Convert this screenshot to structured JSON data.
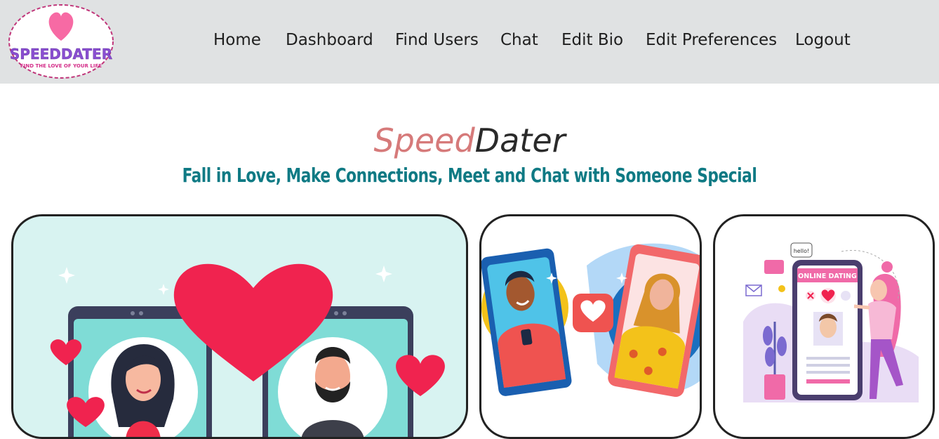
{
  "logo": {
    "title": "SPEEDDATER",
    "tagline": "FIND THE LOVE OF YOUR LIFE"
  },
  "nav": {
    "items": [
      {
        "label": "Home"
      },
      {
        "label": "Dashboard"
      },
      {
        "label": "Find Users"
      },
      {
        "label": "Chat"
      },
      {
        "label": "Edit Bio"
      },
      {
        "label": "Edit Preferences"
      },
      {
        "label": "Logout"
      }
    ]
  },
  "hero": {
    "brand_part1": "Speed",
    "brand_part2": "Dater",
    "tagline": "Fall in Love, Make Connections, Meet and Chat with Someone Special"
  },
  "cards": {
    "card3_screen_title": "ONLINE DATING",
    "card3_bubble": "hello!"
  },
  "colors": {
    "topbar": "#e0e2e3",
    "brand_accent": "#d67a7a",
    "tagline": "#0f7a84",
    "heart": "#f0234f"
  }
}
